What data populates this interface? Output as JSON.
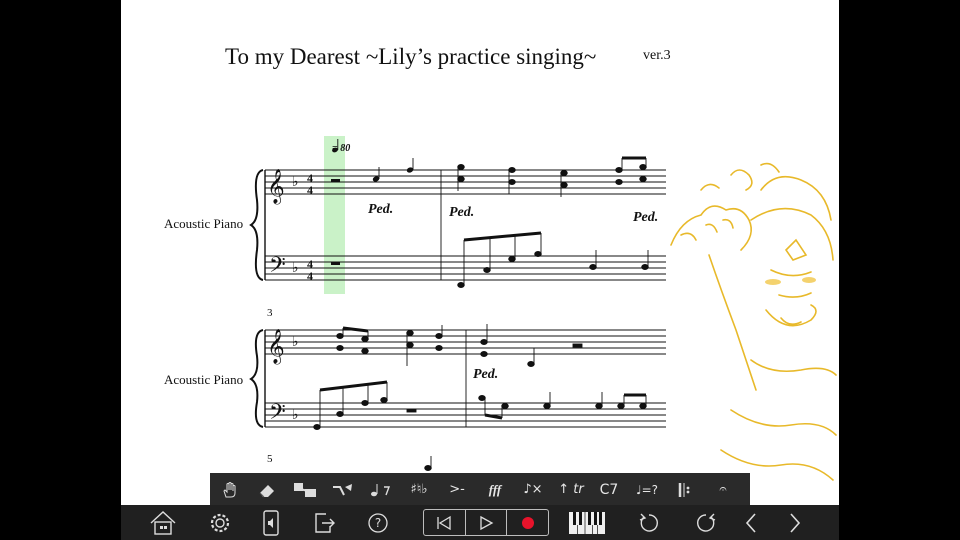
{
  "score": {
    "title": "To my Dearest ~Lily’s practice singing~",
    "version": "ver.3",
    "tempo_marking": "= 80",
    "time_signature": "4/4",
    "key_signature": "F major (one flat)",
    "pedal_mark": "Ped.",
    "systems": [
      {
        "instrument": "Acoustic Piano",
        "measure_number": ""
      },
      {
        "instrument": "Acoustic Piano",
        "measure_number": "3"
      },
      {
        "instrument": "",
        "measure_number": "5"
      }
    ],
    "playhead_color": "#9ee89a"
  },
  "toolbar": {
    "items": [
      {
        "name": "hand-tool-icon",
        "label": ""
      },
      {
        "name": "eraser-icon",
        "label": ""
      },
      {
        "name": "select-notes-icon",
        "label": ""
      },
      {
        "name": "tie-slur-icon",
        "label": ""
      },
      {
        "name": "note-rest-icon",
        "label": ""
      },
      {
        "name": "accidentals-icon",
        "label": ""
      },
      {
        "name": "articulation-icon",
        "label": ">-"
      },
      {
        "name": "dynamics-icon",
        "label": "fff"
      },
      {
        "name": "note-delete-icon",
        "label": ""
      },
      {
        "name": "ornament-icon",
        "label": "tr"
      },
      {
        "name": "chord-symbol-icon",
        "label": "C7"
      },
      {
        "name": "tempo-icon",
        "label": "=?"
      },
      {
        "name": "repeat-barline-icon",
        "label": ""
      },
      {
        "name": "more-icon",
        "label": ""
      }
    ]
  },
  "bottombar": {
    "accent_color": "#e8132b",
    "buttons": [
      "home-icon",
      "settings-gear-icon",
      "device-sound-icon",
      "export-icon",
      "help-icon",
      "skip-to-start-icon",
      "play-icon",
      "record-icon",
      "piano-keyboard-icon",
      "undo-icon",
      "redo-icon",
      "previous-page-icon",
      "next-page-icon"
    ]
  }
}
